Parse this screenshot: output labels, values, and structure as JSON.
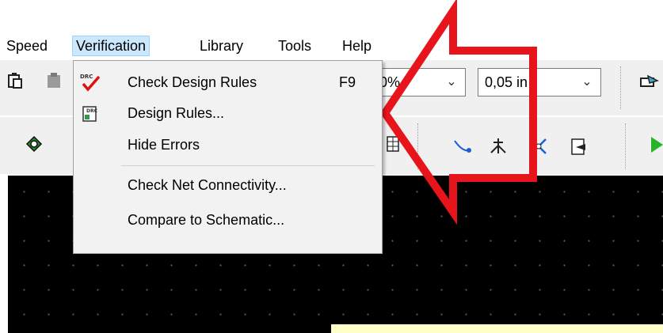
{
  "menubar": {
    "items": [
      {
        "label": "Speed"
      },
      {
        "label": "Verification"
      },
      {
        "label": "Library"
      },
      {
        "label": "Tools"
      },
      {
        "label": "Help"
      }
    ]
  },
  "toolbar": {
    "zoom_value": "0%",
    "grid_value": "0,05 in"
  },
  "verification_menu": {
    "items": [
      {
        "label": "Check Design Rules",
        "shortcut": "F9",
        "icon": "drc-check-icon"
      },
      {
        "label": "Design Rules...",
        "icon": "drc-rules-icon"
      },
      {
        "label": "Hide Errors"
      },
      {
        "label": "Check Net Connectivity..."
      },
      {
        "label": "Compare to Schematic..."
      }
    ]
  },
  "colors": {
    "annotation_arrow": "#e8141c",
    "canvas": "#000000",
    "menu_highlight": "#cce8ff"
  }
}
